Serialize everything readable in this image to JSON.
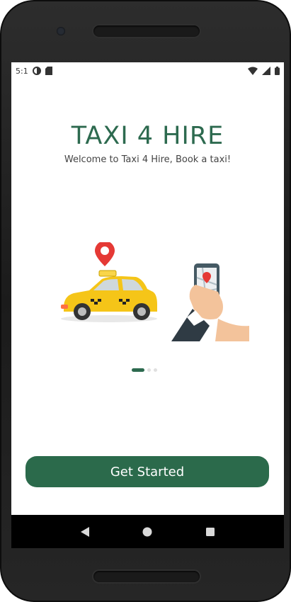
{
  "status_bar": {
    "time": "5:1",
    "icons": [
      "data-saver-icon",
      "sd-card-icon",
      "wifi-icon",
      "signal-icon",
      "battery-icon"
    ]
  },
  "app": {
    "title": "TAXI 4 HIRE",
    "subtitle": "Welcome to Taxi 4 Hire, Book a taxi!"
  },
  "carousel": {
    "illustration_icons": [
      "taxi-icon",
      "location-pin-icon",
      "phone-map-icon",
      "hand-icon"
    ],
    "page_count": 3,
    "active_page": 1
  },
  "actions": {
    "get_started_label": "Get Started"
  },
  "nav": {
    "icons": [
      "back-icon",
      "home-icon",
      "recents-icon"
    ]
  },
  "colors": {
    "accent": "#2b6a4b",
    "title": "#2d6a4f",
    "taxi_yellow": "#f5c518",
    "pin_red": "#e53935"
  }
}
